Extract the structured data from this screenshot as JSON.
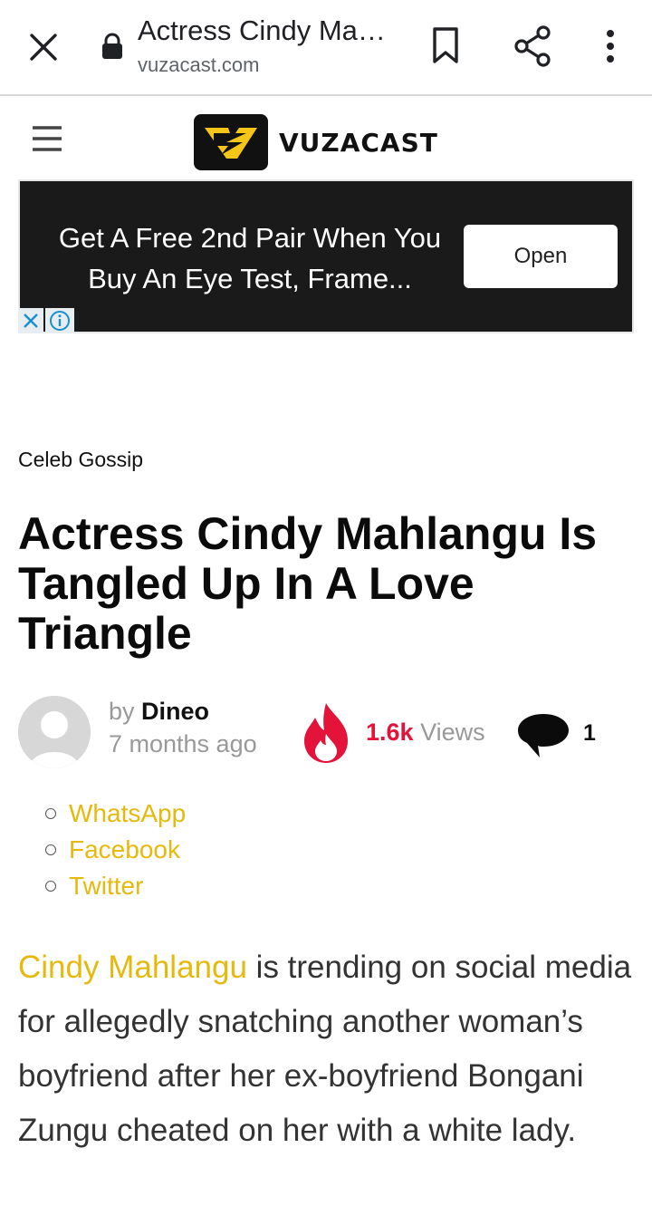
{
  "browser": {
    "title": "Actress Cindy Ma…",
    "url": "vuzacast.com",
    "icons": [
      "close-icon",
      "lock-icon",
      "bookmark-icon",
      "share-icon",
      "more-vert-icon"
    ]
  },
  "site": {
    "logo_text": "VUZACAST",
    "brand_color": "#f5c518"
  },
  "ad": {
    "text": "Get A Free 2nd Pair When You Buy An Eye Test, Frame...",
    "button_label": "Open"
  },
  "article": {
    "category": "Celeb Gossip",
    "headline": "Actress Cindy Mahlangu Is Tangled Up In A Love Triangle",
    "by_prefix": "by",
    "author": "Dineo",
    "time_ago": "7 months ago",
    "views_count": "1.6k",
    "views_label": "Views",
    "comment_count": "1",
    "share_links": [
      "WhatsApp",
      "Facebook",
      "Twitter"
    ],
    "body_link": "Cindy Mahlangu",
    "body_text": " is trending on social media for allegedly snatching another woman’s boyfriend after her ex-boyfriend Bongani Zungu cheated on her with a white lady."
  }
}
